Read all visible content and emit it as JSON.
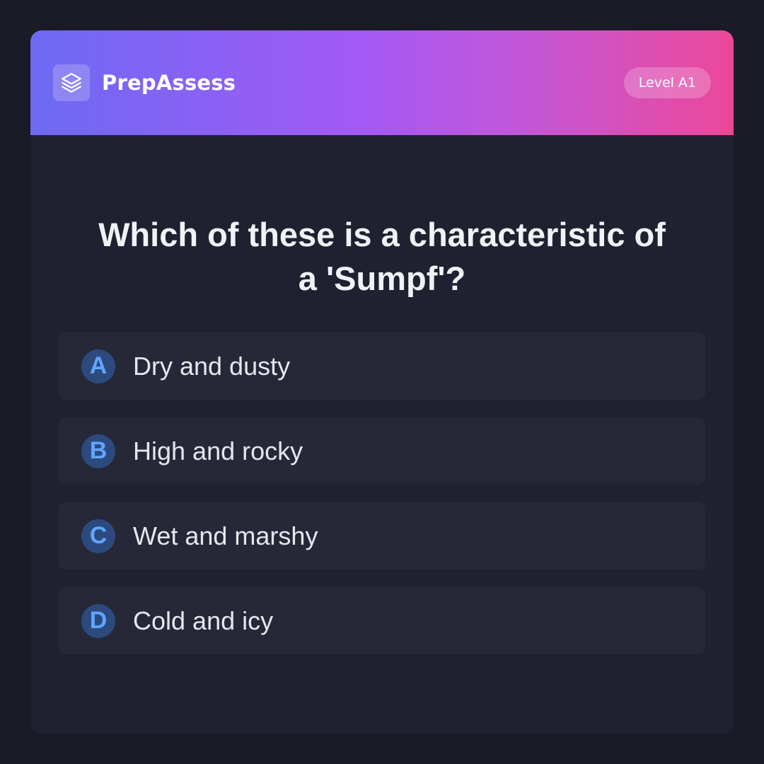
{
  "header": {
    "brand": "PrepAssess",
    "logo_icon": "layers-icon",
    "level_badge": "Level A1"
  },
  "question": {
    "text": "Which of these is a characteristic of a 'Sumpf'?"
  },
  "options": [
    {
      "letter": "A",
      "text": "Dry and dusty"
    },
    {
      "letter": "B",
      "text": "High and rocky"
    },
    {
      "letter": "C",
      "text": "Wet and marshy"
    },
    {
      "letter": "D",
      "text": "Cold and icy"
    }
  ],
  "colors": {
    "gradient_start": "#6d6af2",
    "gradient_mid": "#a459f5",
    "gradient_end": "#ec4899",
    "accent_letter": "#60a5fa"
  }
}
